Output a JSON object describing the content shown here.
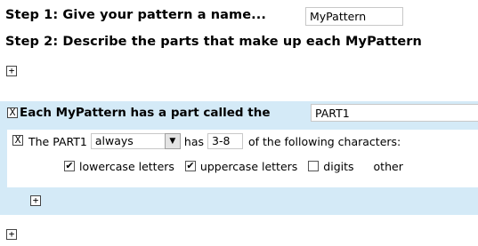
{
  "step1": {
    "label": "Step 1: Give your pattern a name...",
    "value": "MyPattern"
  },
  "step2": {
    "label": "Step 2: Describe the parts that make up each MyPattern"
  },
  "expander": {
    "plus": "+",
    "minus": "X"
  },
  "part": {
    "title": "Each MyPattern has a part called the",
    "name_value": "PART1",
    "rule": {
      "prefix": "The PART1",
      "quantifier": "always",
      "has_label": "has",
      "count_value": "3-8",
      "suffix": "of the following characters:"
    },
    "checkboxes": [
      {
        "label": "lowercase letters",
        "checked": true,
        "mark": "✔"
      },
      {
        "label": "uppercase letters",
        "checked": true,
        "mark": "✔"
      },
      {
        "label": "digits",
        "checked": false,
        "mark": ""
      },
      {
        "label": "other",
        "checked": false,
        "mark": ""
      }
    ]
  },
  "colors": {
    "part_band": "#d4eaf7",
    "textbox_border": "#c8c8c8"
  }
}
